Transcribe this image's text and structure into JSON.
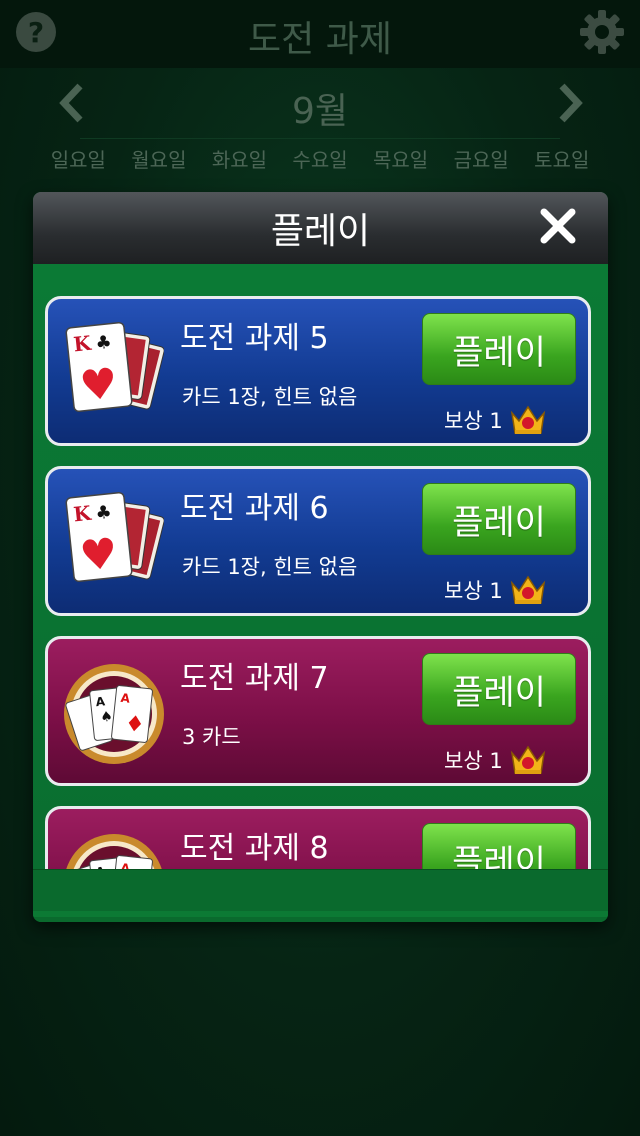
{
  "app": {
    "title": "도전 과제"
  },
  "month_nav": {
    "month": "9월",
    "prev_icon": "chevron-left-icon",
    "next_icon": "chevron-right-icon"
  },
  "weekdays": [
    "일요일",
    "월요일",
    "화요일",
    "수요일",
    "목요일",
    "금요일",
    "토요일"
  ],
  "dialog": {
    "title": "플레이",
    "challenges": [
      {
        "name": "도전 과제 5",
        "desc": "카드 1장, 힌트 없음",
        "play": "플레이",
        "reward": "보상 1",
        "theme": "blue",
        "art": "kings-cards-icon"
      },
      {
        "name": "도전 과제 6",
        "desc": "카드 1장, 힌트 없음",
        "play": "플레이",
        "reward": "보상 1",
        "theme": "blue",
        "art": "kings-cards-icon"
      },
      {
        "name": "도전 과제 7",
        "desc": "3 카드",
        "play": "플레이",
        "reward": "보상 1",
        "theme": "pink",
        "art": "aces-cards-icon"
      },
      {
        "name": "도전 과제 8",
        "desc": "",
        "play": "플레이",
        "reward": "",
        "theme": "pink",
        "art": "aces-cards-icon"
      }
    ]
  },
  "colors": {
    "play_button": "#4cc12a",
    "blue_card": "#1a44a2",
    "pink_card": "#8a1352"
  }
}
